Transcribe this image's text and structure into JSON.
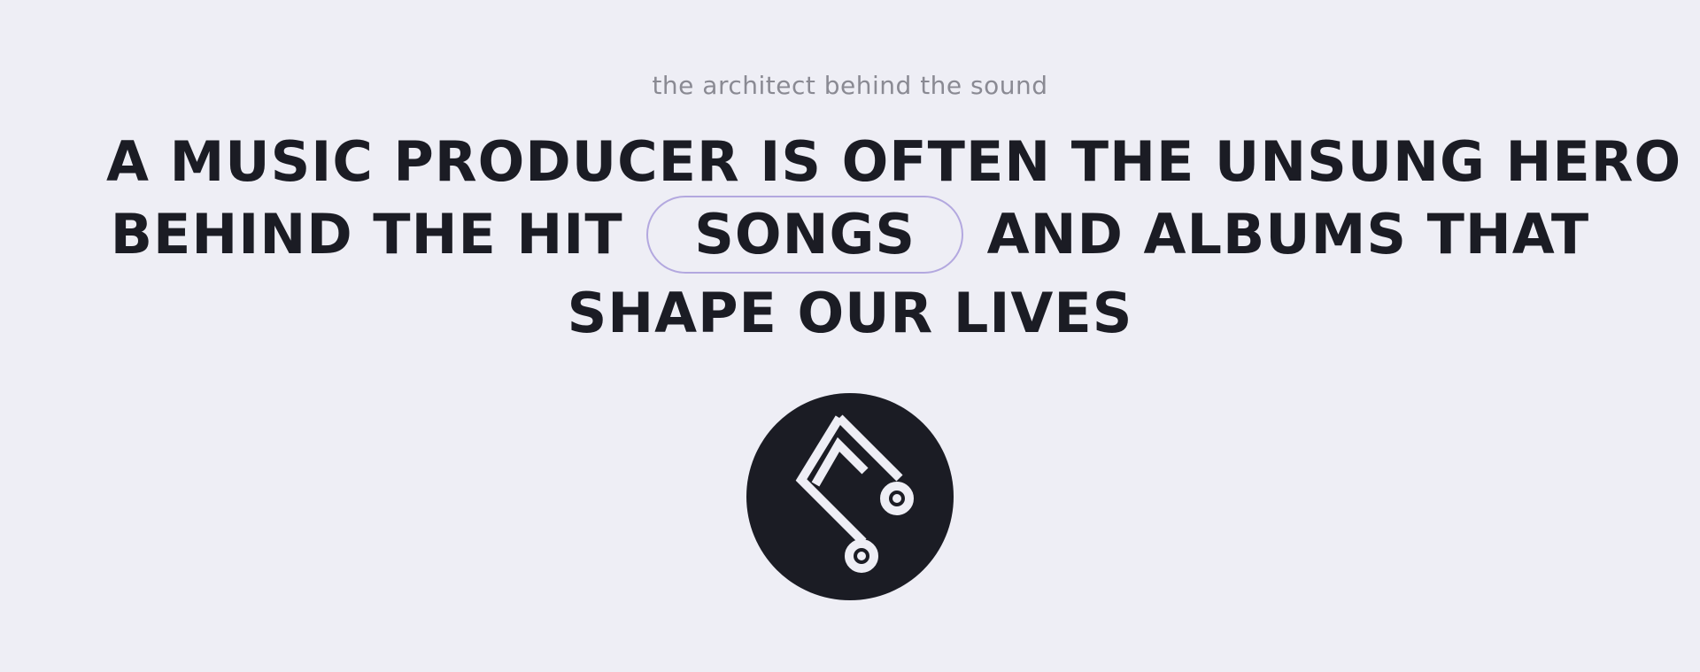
{
  "hero": {
    "tagline": "the architect behind the sound",
    "headline": {
      "line1": "A MUSIC PRODUCER IS OFTEN THE UNSUNG HERO",
      "line2_before": "BEHIND THE HIT",
      "highlight": "SONGS",
      "line2_after": "AND ALBUMS THAT",
      "line3": "SHAPE OUR LIVES"
    },
    "logo_icon": "music-note-icon",
    "colors": {
      "background": "#eeeef5",
      "text": "#1b1c24",
      "tagline": "#8a8a93",
      "pill_border": "#b3a8df",
      "logo_bg": "#1b1c24",
      "logo_fg": "#eeeef5"
    }
  }
}
